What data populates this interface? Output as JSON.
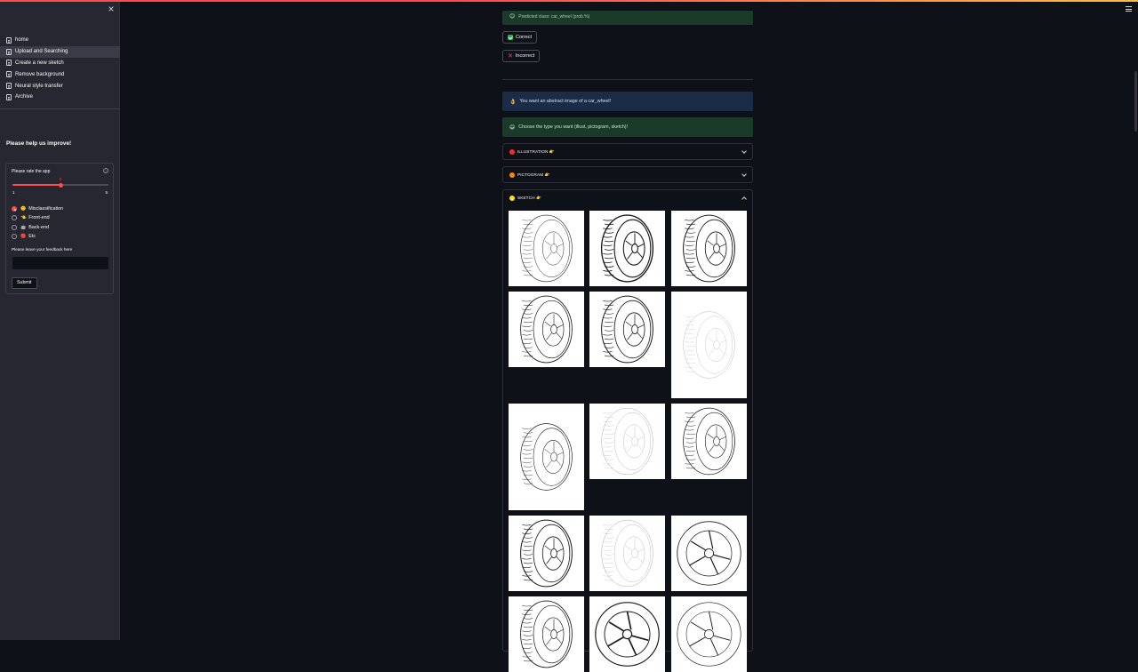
{
  "sidebar": {
    "close_icon": "close-icon",
    "nav": [
      {
        "label": "home",
        "active": false
      },
      {
        "label": "Upload and Searching",
        "active": true
      },
      {
        "label": "Create a new sketch",
        "active": false
      },
      {
        "label": "Remove background",
        "active": false
      },
      {
        "label": "Neural style transfer",
        "active": false
      },
      {
        "label": "Archive",
        "active": false
      }
    ],
    "help_title": "Please help us improve!",
    "form": {
      "rate_label": "Please rate the app",
      "slider": {
        "min": "1",
        "max": "5",
        "value": "3"
      },
      "radios": [
        {
          "emoji": "🙁",
          "label": "Misclassification",
          "selected": true
        },
        {
          "emoji": "👈",
          "label": "Front-end",
          "selected": false
        },
        {
          "emoji": "🤖",
          "label": "Back-end",
          "selected": false
        },
        {
          "emoji": "🔴",
          "label": "Etc",
          "selected": false
        }
      ],
      "feedback_label": "Please leave your feedback here",
      "feedback_value": "",
      "submit_label": "Submit"
    }
  },
  "main": {
    "predicted_text": "Predicted class: car_wheel (prob.%)",
    "correct_label": "Correct",
    "incorrect_label": "Incorrect",
    "info_text": "You want an abstract image of a car_wheel!",
    "choose_text": "Choose the type you want (illust, pictogram, sketch)!",
    "expanders": [
      {
        "label": "ILLUSTRATION 👉",
        "dot_color": "#ff2b2b",
        "expanded": false
      },
      {
        "label": "PICTOGRAM 👉",
        "dot_color": "#ff8700",
        "expanded": false
      },
      {
        "label": "SKETCH 👉",
        "dot_color": "#ffe312",
        "expanded": true
      }
    ]
  },
  "colors": {
    "accent": "#ff4b4b",
    "success_bg": "#1a3a2a",
    "info_bg": "#1b2c46",
    "sidebar_bg": "#262730",
    "page_bg": "#0e1117"
  },
  "chart_data": null
}
